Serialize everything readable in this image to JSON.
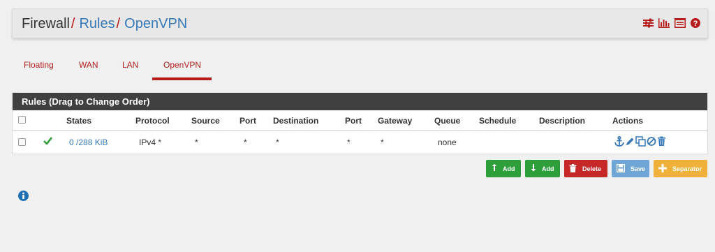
{
  "breadcrumb": {
    "root": "Firewall",
    "sep1": "/",
    "rules": "Rules",
    "sep2": "/",
    "current": "OpenVPN"
  },
  "header_icons": [
    "settings-sliders-icon",
    "bar-chart-icon",
    "log-list-icon",
    "help-icon"
  ],
  "tabs": [
    {
      "label": "Floating",
      "active": false
    },
    {
      "label": "WAN",
      "active": false
    },
    {
      "label": "LAN",
      "active": false
    },
    {
      "label": "OpenVPN",
      "active": true
    }
  ],
  "panel": {
    "title": "Rules (Drag to Change Order)",
    "columns": [
      "States",
      "Protocol",
      "Source",
      "Port",
      "Destination",
      "Port",
      "Gateway",
      "Queue",
      "Schedule",
      "Description",
      "Actions"
    ],
    "rows": [
      {
        "status": "check-icon",
        "states": "0 /288 KiB",
        "protocol": "IPv4 *",
        "source": "*",
        "source_port": "*",
        "destination": "*",
        "destination_port": "*",
        "gateway": "*",
        "queue": "none",
        "schedule": "",
        "description": "",
        "actions": [
          "anchor-icon",
          "pencil-icon",
          "copy-icon",
          "disable-icon",
          "trash-icon"
        ]
      }
    ]
  },
  "buttons": {
    "add_top": "Add",
    "add_bottom": "Add",
    "delete": "Delete",
    "save": "Save",
    "separator": "Separator"
  },
  "colors": {
    "accent_red": "#b71c1c",
    "link_blue": "#3578b8",
    "green": "#2e9e3b",
    "delete_red": "#c62828",
    "save_blue": "#6fa6d6",
    "separator_orange": "#f0b13a"
  }
}
